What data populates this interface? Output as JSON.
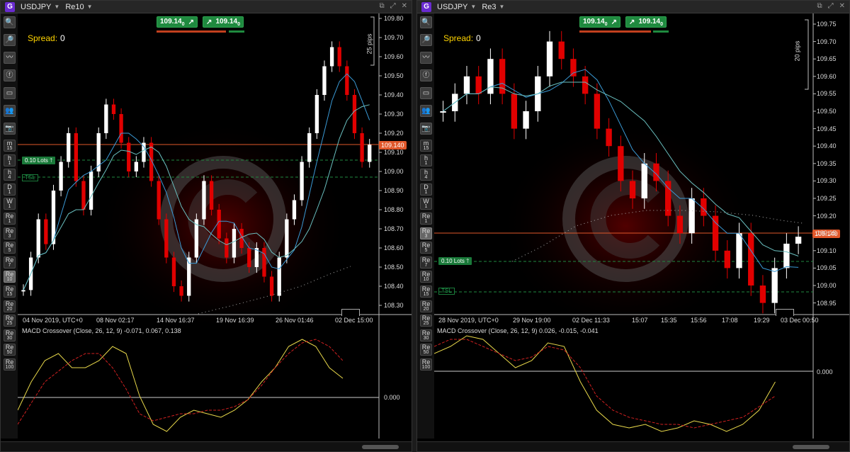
{
  "colors": {
    "up": "#ffffff",
    "down": "#e10000",
    "price_line": "#e0572a",
    "macd": "#e8d84a",
    "signal": "#d02020",
    "ma1": "#3a9ad6",
    "ma2": "#6ac0c0",
    "green": "#1f8a3f"
  },
  "panels": [
    {
      "symbol": "USDJPY",
      "timeframe": "Re10",
      "spread_label": "Spread:",
      "spread_value": "0",
      "sell_price": "109.14",
      "sell_sup": "0",
      "buy_price": "109.14",
      "buy_sup": "0",
      "lots_label": "0.10 Lots",
      "tsl_label": "TSL",
      "pips_label": "25 pips",
      "current_price": "109.140",
      "y_ticks": [
        "109.80",
        "109.70",
        "109.60",
        "109.50",
        "109.40",
        "109.30",
        "109.20",
        "109.10",
        "109.00",
        "108.90",
        "108.80",
        "108.70",
        "108.60",
        "108.50",
        "108.40",
        "108.30"
      ],
      "x_ticks": [
        "04 Nov 2019, UTC+0",
        "08 Nov 02:17",
        "14 Nov 16:37",
        "19 Nov 16:39",
        "26 Nov 01:46",
        "02 Dec 15:00"
      ],
      "macd_label": "MACD Crossover (Close, 26, 12, 9) -0.071, 0.067, 0.138",
      "macd_zero": "0.000",
      "toolbar_tf": [
        [
          "m",
          "15"
        ],
        [
          "h",
          "1"
        ],
        [
          "h",
          "4"
        ],
        [
          "D",
          "1"
        ],
        [
          "W",
          "1"
        ],
        [
          "Re",
          "1"
        ],
        [
          "Re",
          "3"
        ],
        [
          "Re",
          "5"
        ],
        [
          "Re",
          "7"
        ],
        [
          "Re",
          "10"
        ],
        [
          "Re",
          "15"
        ],
        [
          "Re",
          "20"
        ],
        [
          "Re",
          "25"
        ],
        [
          "Re",
          "30"
        ],
        [
          "Re",
          "50"
        ],
        [
          "Re",
          "100"
        ]
      ],
      "selected_tf": "Re 10"
    },
    {
      "symbol": "USDJPY",
      "timeframe": "Re3",
      "spread_label": "Spread:",
      "spread_value": "0",
      "sell_price": "109.14",
      "sell_sup": "0",
      "buy_price": "109.14",
      "buy_sup": "0",
      "lots_label": "0.10 Lots",
      "tsl_label": "TSL",
      "pips_label": "20 pips",
      "current_price": "109.140",
      "y_ticks": [
        "109.75",
        "109.70",
        "109.65",
        "109.60",
        "109.55",
        "109.50",
        "109.45",
        "109.40",
        "109.35",
        "109.30",
        "109.25",
        "109.20",
        "109.15",
        "109.10",
        "109.05",
        "109.00",
        "108.95"
      ],
      "x_ticks": [
        "28 Nov 2019, UTC+0",
        "29 Nov 19:00",
        "02 Dec 11:33",
        "15:07",
        "15:35",
        "15:56",
        "17:08",
        "19:29",
        "03 Dec 00:50"
      ],
      "macd_label": "MACD Crossover (Close, 26, 12, 9) 0.026, -0.015, -0.041",
      "macd_zero": "0.000",
      "toolbar_tf": [
        [
          "m",
          "15"
        ],
        [
          "h",
          "1"
        ],
        [
          "h",
          "4"
        ],
        [
          "D",
          "1"
        ],
        [
          "W",
          "1"
        ],
        [
          "Re",
          "1"
        ],
        [
          "Re",
          "3"
        ],
        [
          "Re",
          "5"
        ],
        [
          "Re",
          "7"
        ],
        [
          "Re",
          "10"
        ],
        [
          "Re",
          "15"
        ],
        [
          "Re",
          "20"
        ],
        [
          "Re",
          "25"
        ],
        [
          "Re",
          "30"
        ],
        [
          "Re",
          "50"
        ],
        [
          "Re",
          "100"
        ]
      ],
      "selected_tf": "Re 3"
    }
  ],
  "tool_icons": [
    "zoom-in-icon",
    "zoom-out-icon",
    "indicator-icon",
    "cfx-icon",
    "calendar-icon",
    "people-icon",
    "camera-icon"
  ],
  "chart_data": [
    {
      "type": "candlestick",
      "symbol": "USDJPY",
      "timeframe": "Re10",
      "last": 109.14,
      "close_path": [
        108.38,
        108.55,
        108.75,
        108.62,
        108.9,
        109.05,
        109.2,
        108.95,
        108.8,
        109.0,
        109.2,
        109.35,
        109.3,
        109.15,
        109.0,
        109.05,
        109.15,
        108.95,
        108.75,
        108.55,
        108.4,
        108.35,
        108.55,
        108.75,
        108.95,
        108.8,
        108.65,
        108.55,
        108.7,
        108.6,
        108.5,
        108.6,
        108.45,
        108.35,
        108.55,
        108.75,
        108.85,
        109.05,
        109.2,
        109.4,
        109.55,
        109.65,
        109.55,
        109.4,
        109.2,
        109.05,
        109.14
      ],
      "macd": {
        "zero": 0.0,
        "last": -0.071,
        "signal_last": 0.067,
        "hist_last": 0.138
      }
    },
    {
      "type": "candlestick",
      "symbol": "USDJPY",
      "timeframe": "Re3",
      "last": 109.14,
      "close_path": [
        109.5,
        109.55,
        109.6,
        109.55,
        109.65,
        109.55,
        109.45,
        109.5,
        109.6,
        109.7,
        109.65,
        109.6,
        109.55,
        109.45,
        109.4,
        109.3,
        109.25,
        109.35,
        109.3,
        109.2,
        109.15,
        109.25,
        109.2,
        109.1,
        109.05,
        109.15,
        109.0,
        108.95,
        109.05,
        109.12,
        109.14
      ],
      "macd": {
        "zero": 0.0,
        "last": 0.026,
        "signal_last": -0.015,
        "hist_last": -0.041
      }
    }
  ]
}
